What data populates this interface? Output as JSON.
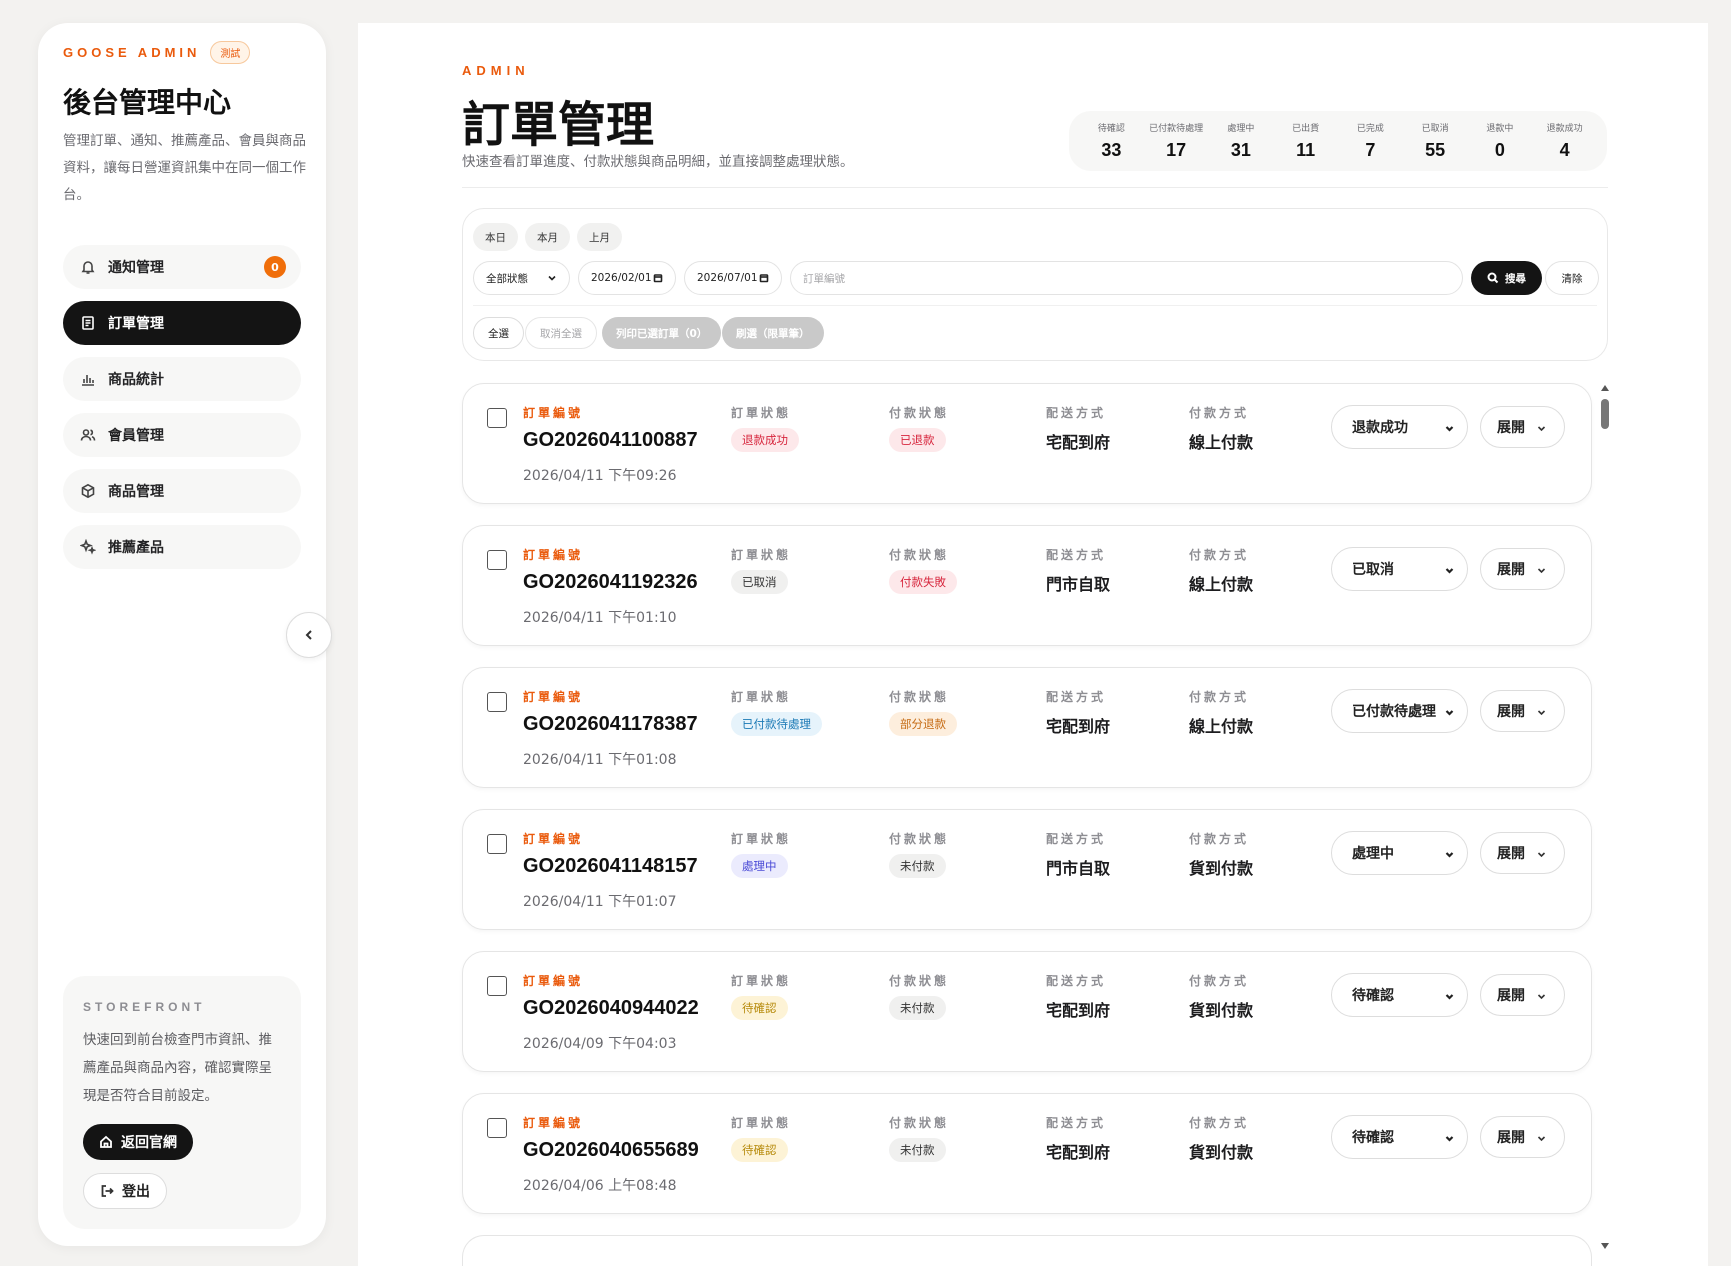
{
  "sidebar": {
    "brand": "GOOSE ADMIN",
    "badge": "測試",
    "title": "後台管理中心",
    "description": "管理訂單、通知、推薦產品、會員與商品資料，讓每日營運資訊集中在同一個工作台。",
    "items": [
      {
        "label": "通知管理",
        "icon": "bell-icon",
        "count": "0"
      },
      {
        "label": "訂單管理",
        "icon": "document-icon",
        "active": true
      },
      {
        "label": "商品統計",
        "icon": "bar-chart-icon"
      },
      {
        "label": "會員管理",
        "icon": "users-icon"
      },
      {
        "label": "商品管理",
        "icon": "box-icon"
      },
      {
        "label": "推薦產品",
        "icon": "sparkle-icon"
      }
    ],
    "storefront": {
      "label": "STOREFRONT",
      "description": "快速回到前台檢查門市資訊、推薦產品與商品內容，確認實際呈現是否符合目前設定。",
      "home_label": "返回官網",
      "logout_label": "登出"
    }
  },
  "header": {
    "eyebrow": "ADMIN",
    "title": "訂單管理",
    "description": "快速查看訂單進度、付款狀態與商品明細，並直接調整處理狀態。"
  },
  "stats": [
    {
      "label": "待確認",
      "value": "33"
    },
    {
      "label": "已付款待處理",
      "value": "17"
    },
    {
      "label": "處理中",
      "value": "31"
    },
    {
      "label": "已出貨",
      "value": "11"
    },
    {
      "label": "已完成",
      "value": "7"
    },
    {
      "label": "已取消",
      "value": "55"
    },
    {
      "label": "退款中",
      "value": "0"
    },
    {
      "label": "退款成功",
      "value": "4"
    }
  ],
  "filters": {
    "quick_ranges": [
      "本日",
      "本月",
      "上月"
    ],
    "status_select": "全部狀態",
    "date_from": "2026/02/01",
    "date_to": "2026/07/01",
    "order_placeholder": "訂單編號",
    "search_label": "搜尋",
    "clear_label": "清除",
    "select_all": "全選",
    "deselect_all": "取消全選",
    "print_selected": "列印已選訂單（0）",
    "preview": "刷選（限單筆）"
  },
  "columns": {
    "order_no": "訂單編號",
    "order_status": "訂單狀態",
    "payment_status": "付款狀態",
    "shipping": "配送方式",
    "payment_method": "付款方式",
    "expand": "展開"
  },
  "colors": {
    "accent": "#ea5a0c",
    "dark": "#141414",
    "pill_red_bg": "#fde8ea",
    "pill_red_fg": "#d7263d",
    "pill_gray_bg": "#f0f0ef",
    "pill_gray_fg": "#333333",
    "pill_blue_bg": "#e6f3fb",
    "pill_blue_fg": "#1a79b5",
    "pill_orange_bg": "#fdeedd",
    "pill_orange_fg": "#c56a12",
    "pill_purple_bg": "#ebebfd",
    "pill_purple_fg": "#4a4ad6",
    "pill_yellow_bg": "#fdf3d6",
    "pill_yellow_fg": "#b68a0a"
  },
  "orders": [
    {
      "id": "GO2026041100887",
      "date": "2026/04/11 下午09:26",
      "order_status": "退款成功",
      "order_status_tone": "red",
      "payment_status": "已退款",
      "payment_status_tone": "red",
      "shipping": "宅配到府",
      "payment_method": "線上付款",
      "select": "退款成功"
    },
    {
      "id": "GO2026041192326",
      "date": "2026/04/11 下午01:10",
      "order_status": "已取消",
      "order_status_tone": "gray",
      "payment_status": "付款失敗",
      "payment_status_tone": "red",
      "shipping": "門市自取",
      "payment_method": "線上付款",
      "select": "已取消"
    },
    {
      "id": "GO2026041178387",
      "date": "2026/04/11 下午01:08",
      "order_status": "已付款待處理",
      "order_status_tone": "blue",
      "payment_status": "部分退款",
      "payment_status_tone": "orange",
      "shipping": "宅配到府",
      "payment_method": "線上付款",
      "select": "已付款待處理"
    },
    {
      "id": "GO2026041148157",
      "date": "2026/04/11 下午01:07",
      "order_status": "處理中",
      "order_status_tone": "purple",
      "payment_status": "未付款",
      "payment_status_tone": "gray",
      "shipping": "門市自取",
      "payment_method": "貨到付款",
      "select": "處理中"
    },
    {
      "id": "GO2026040944022",
      "date": "2026/04/09 下午04:03",
      "order_status": "待確認",
      "order_status_tone": "yellow",
      "payment_status": "未付款",
      "payment_status_tone": "gray",
      "shipping": "宅配到府",
      "payment_method": "貨到付款",
      "select": "待確認"
    },
    {
      "id": "GO2026040655689",
      "date": "2026/04/06 上午08:48",
      "order_status": "待確認",
      "order_status_tone": "yellow",
      "payment_status": "未付款",
      "payment_status_tone": "gray",
      "shipping": "宅配到府",
      "payment_method": "貨到付款",
      "select": "待確認"
    }
  ]
}
